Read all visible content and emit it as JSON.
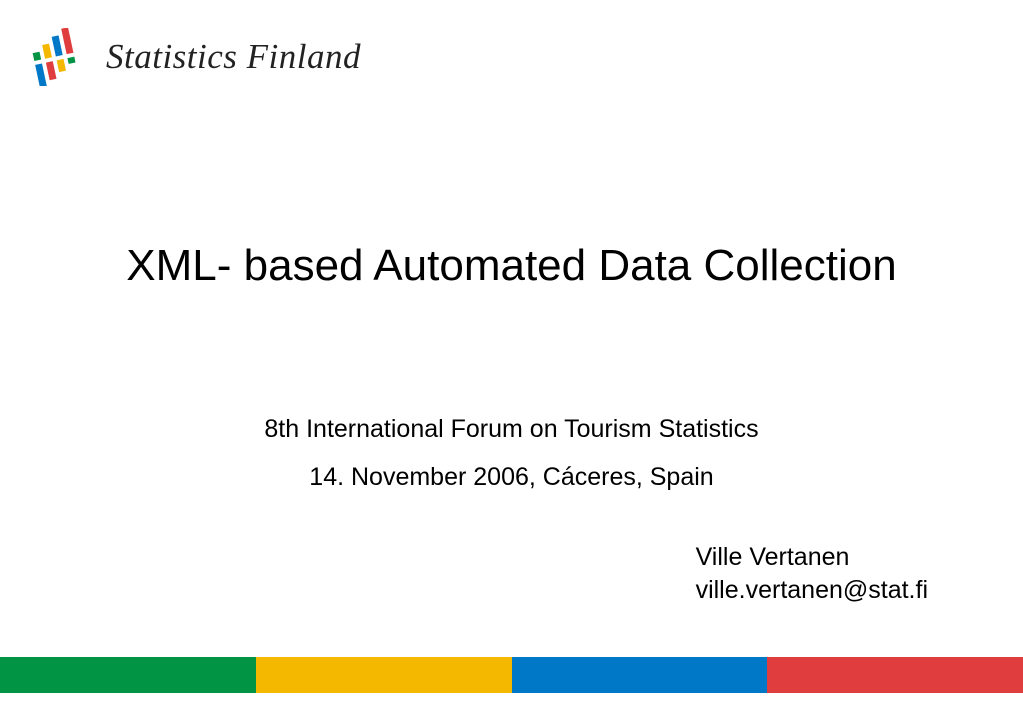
{
  "brand": {
    "name": "Statistics Finland",
    "logo_colors": {
      "green": "#009444",
      "yellow": "#f5b800",
      "blue": "#0078c8",
      "red": "#e03e3e"
    }
  },
  "title": "XML- based Automated Data Collection",
  "subtitle": {
    "line1": "8th International Forum on Tourism Statistics",
    "line2": "14. November 2006, Cáceres, Spain"
  },
  "author": {
    "name": "Ville Vertanen",
    "email": "ville.vertanen@stat.fi"
  },
  "footer_colors": [
    "#009444",
    "#f5b800",
    "#0078c8",
    "#e03e3e"
  ]
}
